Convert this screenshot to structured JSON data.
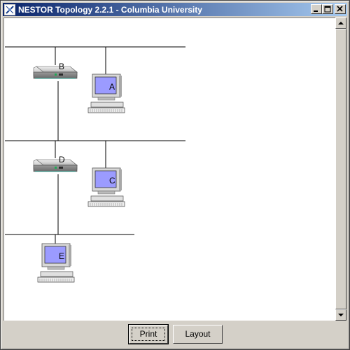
{
  "window": {
    "title": "NESTOR Topology 2.2.1 - Columbia University",
    "title_icon": "nestor-app-icon",
    "minimize_icon": "minimize-icon",
    "maximize_icon": "maximize-icon",
    "close_icon": "close-icon"
  },
  "topology": {
    "nodes": [
      {
        "id": "B",
        "type": "router",
        "label": "B"
      },
      {
        "id": "A",
        "type": "workstation",
        "label": "A"
      },
      {
        "id": "D",
        "type": "router",
        "label": "D"
      },
      {
        "id": "C",
        "type": "workstation",
        "label": "C"
      },
      {
        "id": "E",
        "type": "workstation",
        "label": "E"
      }
    ]
  },
  "scrollbar": {
    "up_icon": "scroll-up-icon",
    "down_icon": "scroll-down-icon"
  },
  "buttons": {
    "print_label": "Print",
    "layout_label": "Layout"
  }
}
